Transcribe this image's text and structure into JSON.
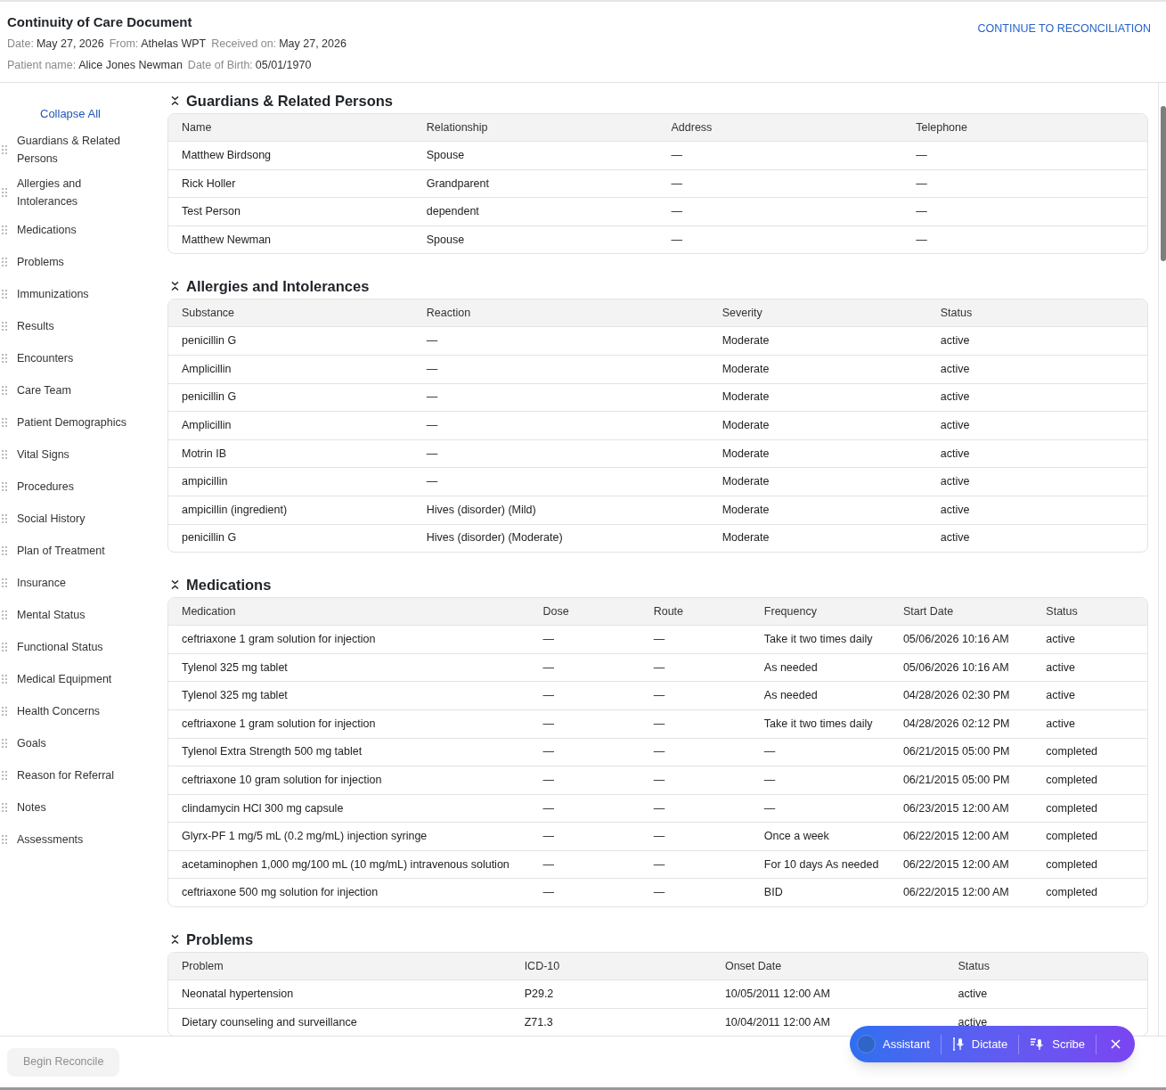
{
  "header": {
    "title": "Continuity of Care Document",
    "action": "CONTINUE TO RECONCILIATION",
    "line_1": [
      {
        "label": "Date:",
        "value": "May 27, 2026"
      },
      {
        "label": "From:",
        "value": "Athelas WPT"
      },
      {
        "label": "Received on:",
        "value": "May 27, 2026"
      }
    ],
    "line_2": [
      {
        "label": "Patient name:",
        "value": "Alice Jones Newman"
      },
      {
        "label": "Date of Birth:",
        "value": "05/01/1970"
      }
    ]
  },
  "sidebar": {
    "collapse_all": "Collapse All",
    "items": [
      "Guardians & Related Persons",
      "Allergies and Intolerances",
      "Medications",
      "Problems",
      "Immunizations",
      "Results",
      "Encounters",
      "Care Team",
      "Patient Demographics",
      "Vital Signs",
      "Procedures",
      "Social History",
      "Plan of Treatment",
      "Insurance",
      "Mental Status",
      "Functional Status",
      "Medical Equipment",
      "Health Concerns",
      "Goals",
      "Reason for Referral",
      "Notes",
      "Assessments"
    ]
  },
  "sections": [
    {
      "title": "Guardians & Related Persons",
      "columns": [
        "Name",
        "Relationship",
        "Address",
        "Telephone"
      ],
      "rows": [
        [
          "Matthew Birdsong",
          "Spouse",
          "—",
          "—"
        ],
        [
          "Rick Holler",
          "Grandparent",
          "—",
          "—"
        ],
        [
          "Test Person",
          "dependent",
          "—",
          "—"
        ],
        [
          "Matthew Newman",
          "Spouse",
          "—",
          "—"
        ]
      ]
    },
    {
      "title": "Allergies and Intolerances",
      "columns": [
        "Substance",
        "Reaction",
        "Severity",
        "Status"
      ],
      "rows": [
        [
          "penicillin G",
          "—",
          "Moderate",
          "active"
        ],
        [
          "Amplicillin",
          "—",
          "Moderate",
          "active"
        ],
        [
          "penicillin G",
          "—",
          "Moderate",
          "active"
        ],
        [
          "Amplicillin",
          "—",
          "Moderate",
          "active"
        ],
        [
          "Motrin IB",
          "—",
          "Moderate",
          "active"
        ],
        [
          "ampicillin",
          "—",
          "Moderate",
          "active"
        ],
        [
          "ampicillin (ingredient)",
          "Hives (disorder) (Mild)",
          "Moderate",
          "active"
        ],
        [
          "penicillin G",
          "Hives (disorder) (Moderate)",
          "Moderate",
          "active"
        ]
      ]
    },
    {
      "title": "Medications",
      "columns": [
        "Medication",
        "Dose",
        "Route",
        "Frequency",
        "Start Date",
        "Status"
      ],
      "rows": [
        [
          "ceftriaxone 1 gram solution for injection",
          "—",
          "—",
          "Take it two times daily",
          "05/06/2026 10:16 AM",
          "active"
        ],
        [
          "Tylenol 325 mg tablet",
          "—",
          "—",
          "As needed",
          "05/06/2026 10:16 AM",
          "active"
        ],
        [
          "Tylenol 325 mg tablet",
          "—",
          "—",
          "As needed",
          "04/28/2026 02:30 PM",
          "active"
        ],
        [
          "ceftriaxone 1 gram solution for injection",
          "—",
          "—",
          "Take it two times daily",
          "04/28/2026 02:12 PM",
          "active"
        ],
        [
          "Tylenol Extra Strength 500 mg tablet",
          "—",
          "—",
          "—",
          "06/21/2015 05:00 PM",
          "completed"
        ],
        [
          "ceftriaxone 10 gram solution for injection",
          "—",
          "—",
          "—",
          "06/21/2015 05:00 PM",
          "completed"
        ],
        [
          "clindamycin HCl 300 mg capsule",
          "—",
          "—",
          "—",
          "06/23/2015 12:00 AM",
          "completed"
        ],
        [
          "Glyrx-PF 1 mg/5 mL (0.2 mg/mL) injection syringe",
          "—",
          "—",
          "Once a week",
          "06/22/2015 12:00 AM",
          "completed"
        ],
        [
          "acetaminophen 1,000 mg/100 mL (10 mg/mL) intravenous solution",
          "—",
          "—",
          "For 10 days As needed",
          "06/22/2015 12:00 AM",
          "completed"
        ],
        [
          "ceftriaxone 500 mg solution for injection",
          "—",
          "—",
          "BID",
          "06/22/2015 12:00 AM",
          "completed"
        ]
      ]
    },
    {
      "title": "Problems",
      "columns": [
        "Problem",
        "ICD-10",
        "Onset Date",
        "Status"
      ],
      "rows": [
        [
          "Neonatal hypertension",
          "P29.2",
          "10/05/2011 12:00 AM",
          "active"
        ],
        [
          "Dietary counseling and surveillance",
          "Z71.3",
          "10/04/2011 12:00 AM",
          "active"
        ]
      ]
    }
  ],
  "footer": {
    "button": "Begin Reconcile",
    "disabled": true
  },
  "toolbar": {
    "items": [
      "Assistant",
      "Dictate",
      "Scribe"
    ]
  }
}
